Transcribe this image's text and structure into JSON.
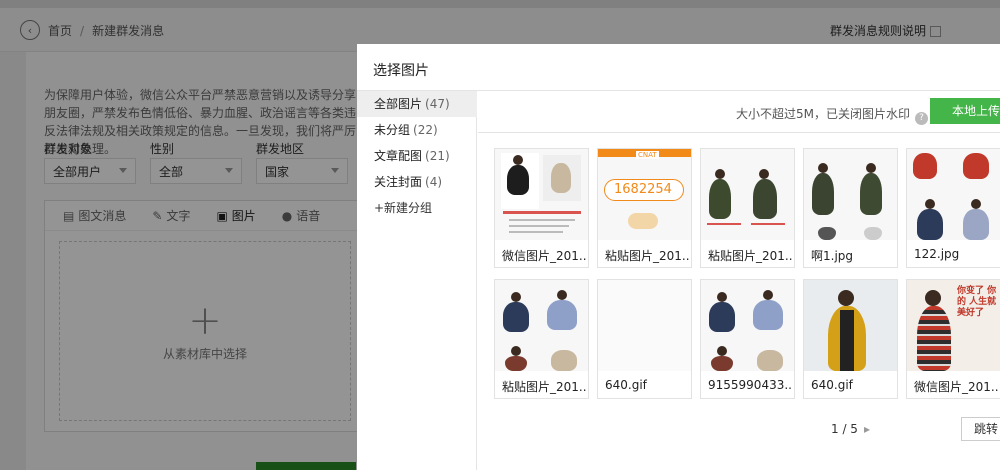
{
  "page": {
    "breadcrumb_home": "首页",
    "breadcrumb_sep": "/",
    "breadcrumb_current": "新建群发消息",
    "rules_link": "群发消息规则说明",
    "notice": "为保障用户体验，微信公众平台严禁恶意营销以及诱导分享朋友圈，严禁发布色情低俗、暴力血腥、政治谣言等各类违反法律法规及相关政策规定的信息。一旦发现，我们将严厉打击和处理。",
    "fields": [
      {
        "label": "群发对象",
        "value": "全部用户"
      },
      {
        "label": "性别",
        "value": "全部"
      },
      {
        "label": "群发地区",
        "value": "国家"
      }
    ],
    "editor_tabs": [
      {
        "label": "图文消息",
        "icon": "article-icon"
      },
      {
        "label": "文字",
        "icon": "pen-icon"
      },
      {
        "label": "图片",
        "icon": "image-icon"
      },
      {
        "label": "语音",
        "icon": "mic-icon"
      }
    ],
    "editor_plus": "+",
    "editor_pick": "从素材库中选择"
  },
  "modal": {
    "title": "选择图片",
    "groups": [
      {
        "name": "全部图片",
        "count": "(47)"
      },
      {
        "name": "未分组",
        "count": "(22)"
      },
      {
        "name": "文章配图",
        "count": "(21)"
      },
      {
        "name": "关注封面",
        "count": "(4)"
      }
    ],
    "add_group": "+新建分组",
    "upload_hint": "大小不超过5M，已关闭图片水印",
    "help": "?",
    "upload_button": "本地上传",
    "images": [
      {
        "name": "微信图片_201..."
      },
      {
        "name": "粘贴图片_201..."
      },
      {
        "name": "粘贴图片_201..."
      },
      {
        "name": "啊1.jpg"
      },
      {
        "name": "122.jpg"
      },
      {
        "name": "粘贴图片_201..."
      },
      {
        "name": "640.gif"
      },
      {
        "name": "9155990433..."
      },
      {
        "name": "640.gif"
      },
      {
        "name": "微信图片_201..."
      }
    ],
    "thumb_text": {
      "phone": "1682254",
      "tag": "CNAT",
      "note": "你变了 你的 人生就 美好了"
    },
    "pager": "1 / 5",
    "pager_next": "▸",
    "jump": "跳转"
  },
  "colors": {
    "accent_green": "#44b549"
  }
}
